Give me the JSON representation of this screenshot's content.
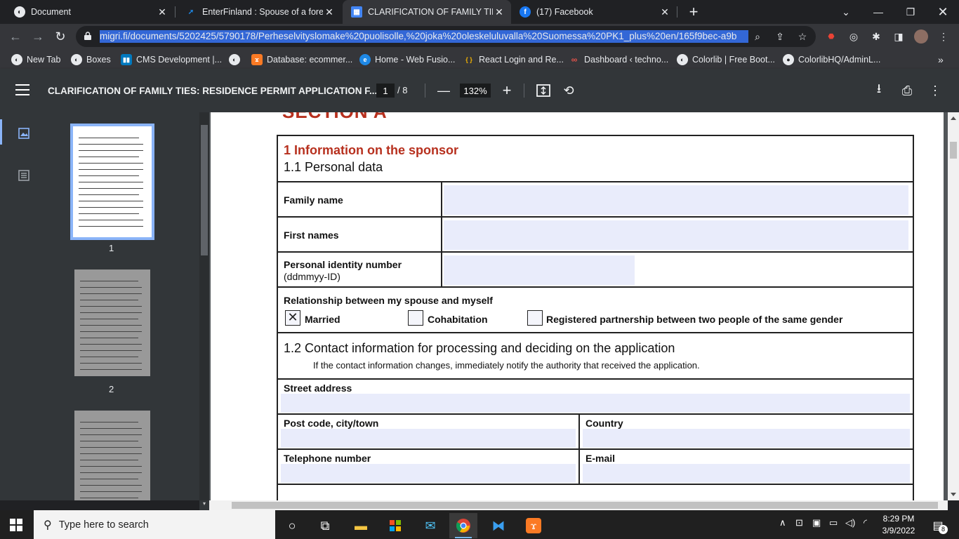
{
  "browser": {
    "tabs": [
      {
        "title": "Document",
        "icon": "globe-icon",
        "color": "#ffffff"
      },
      {
        "title": "EnterFinland : Spouse of a foreign",
        "icon": "enterfinland-icon",
        "color": "#1e88e5"
      },
      {
        "title": "CLARIFICATION OF FAMILY TIES:",
        "icon": "pdf-doc-icon",
        "color": "#4285f4"
      },
      {
        "title": "(17) Facebook",
        "icon": "facebook-icon",
        "color": "#1877f2"
      }
    ],
    "url": "migri.fi/documents/5202425/5790178/Perheselvityslomake%20puolisolle,%20joka%20oleskeluluvalla%20Suomessa%20PK1_plus%20en/165f9bec-a9b",
    "bookmarks": [
      {
        "label": "New Tab",
        "icon": "globe-icon"
      },
      {
        "label": "Boxes",
        "icon": "globe-icon"
      },
      {
        "label": "CMS Development |...",
        "icon": "trello-icon"
      },
      {
        "label": "",
        "icon": "globe-icon"
      },
      {
        "label": "Database: ecommer...",
        "icon": "xampp-icon"
      },
      {
        "label": "Home - Web Fusio...",
        "icon": "edge-icon"
      },
      {
        "label": "React Login and Re...",
        "icon": "codepen-icon"
      },
      {
        "label": "Dashboard ‹ techno...",
        "icon": "infinity-icon"
      },
      {
        "label": "Colorlib | Free Boot...",
        "icon": "globe-icon"
      },
      {
        "label": "ColorlibHQ/AdminL...",
        "icon": "github-icon"
      }
    ]
  },
  "pdf": {
    "title": "CLARIFICATION OF FAMILY TIES: RESIDENCE PERMIT APPLICATION F...",
    "current_page": "1",
    "total_pages": "/ 8",
    "zoom": "132%",
    "thumbnails": [
      "1",
      "2"
    ]
  },
  "form": {
    "section_heading": "SECTION A",
    "sponsor_heading": "1  Information on the sponsor",
    "personal_data": "1.1   Personal data",
    "family_name": "Family name",
    "first_names": "First names",
    "pin_label": "Personal identity number",
    "pin_format": "(ddmmyy-ID)",
    "relationship_label": "Relationship between my spouse and myself",
    "options": [
      {
        "label": "Married",
        "checked": true
      },
      {
        "label": "Cohabitation",
        "checked": false
      },
      {
        "label": "Registered partnership between two people of the same gender",
        "checked": false
      }
    ],
    "contact_heading": "1.2   Contact information for processing and deciding on the application",
    "contact_note": "If the contact information changes, immediately notify the authority that received the application.",
    "street_address": "Street address",
    "post_code": "Post code, city/town",
    "country": "Country",
    "telephone": "Telephone number",
    "email": "E-mail",
    "check_mark": "✕"
  },
  "taskbar": {
    "search_placeholder": "Type here to search",
    "time": "8:29 PM",
    "date": "3/9/2022",
    "notification_count": "8"
  }
}
